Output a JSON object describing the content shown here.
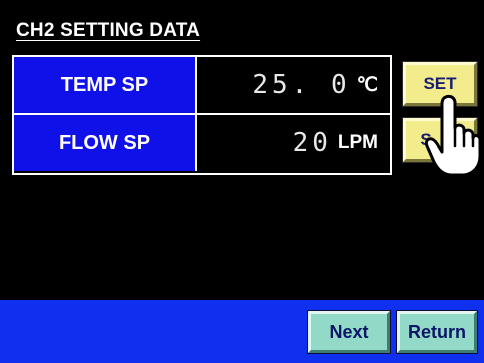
{
  "screen": {
    "title": "CH2 SETTING DATA",
    "colors": {
      "background": "#000000",
      "label_cell": "#1010E8",
      "set_button": "#F2EC8C",
      "footer": "#1030F0",
      "nav_button": "#92D9C8"
    }
  },
  "rows": [
    {
      "label": "TEMP SP",
      "value": "25. 0",
      "unit": "℃",
      "button_label": "SET"
    },
    {
      "label": "FLOW SP",
      "value": "20",
      "unit": "LPM",
      "button_label": "S"
    }
  ],
  "cursor": {
    "icon": "hand-pointer-icon"
  },
  "footer": {
    "next_label": "Next",
    "return_label": "Return"
  }
}
